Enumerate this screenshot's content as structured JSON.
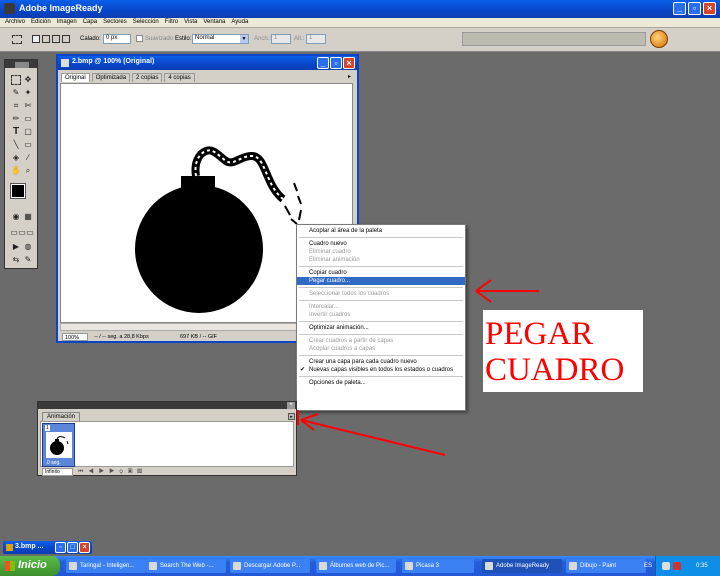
{
  "app": {
    "title": "Adobe ImageReady"
  },
  "menubar": [
    "Archivo",
    "Edición",
    "Imagen",
    "Capa",
    "Sectores",
    "Selección",
    "Filtro",
    "Vista",
    "Ventana",
    "Ayuda"
  ],
  "options_bar": {
    "calado_label": "Calado:",
    "calado_value": "0 px",
    "suavizado_label": "Suavizado",
    "estilo_label": "Estilo:",
    "estilo_value": "Normal",
    "ancho_label": "Anch.:",
    "ancho_value": "1",
    "alt_label": "Alt.:",
    "alt_value": "1"
  },
  "document": {
    "title": "2.bmp @ 100% (Original)",
    "tabs": [
      "Original",
      "Optimizada",
      "2 copias",
      "4 copias"
    ],
    "zoom": "100%",
    "status_speed": "-- / -- seg. a 28,8 Kbps",
    "status_size": "697 KB / -- GIF"
  },
  "context_menu": {
    "items": [
      {
        "label": "Acoplar al área de la paleta",
        "state": "normal"
      },
      {
        "sep": true
      },
      {
        "label": "Cuadro nuevo",
        "state": "normal"
      },
      {
        "label": "Eliminar cuadro",
        "state": "disabled"
      },
      {
        "label": "Eliminar animación",
        "state": "disabled"
      },
      {
        "sep": true
      },
      {
        "label": "Copiar cuadro",
        "state": "normal"
      },
      {
        "label": "Pegar cuadro...",
        "state": "highlighted"
      },
      {
        "sep": true
      },
      {
        "label": "Seleccionar todos los cuadros",
        "state": "disabled"
      },
      {
        "sep": true
      },
      {
        "label": "Intercalar...",
        "state": "disabled"
      },
      {
        "label": "Invertir cuadros",
        "state": "disabled"
      },
      {
        "sep": true
      },
      {
        "label": "Optimizar animación...",
        "state": "normal"
      },
      {
        "sep": true
      },
      {
        "label": "Crear cuadros a partir de capas",
        "state": "disabled"
      },
      {
        "label": "Acoplar cuadros a capas",
        "state": "disabled"
      },
      {
        "sep": true
      },
      {
        "label": "Crear una capa para cada cuadro nuevo",
        "state": "normal"
      },
      {
        "label": "Nuevas capas visibles en todos los estados o cuadros",
        "state": "checked"
      },
      {
        "sep": true
      },
      {
        "label": "Opciones de paleta...",
        "state": "normal"
      }
    ]
  },
  "annotation": {
    "line1": "PEGAR",
    "line2": "CUADRO",
    "color": "#ff0000"
  },
  "animation_palette": {
    "tab": "Animación",
    "frame_number": "1",
    "frame_delay": "0 seg.",
    "loop": "Infinito"
  },
  "minimized_doc": {
    "title": "3.bmp ..."
  },
  "taskbar": {
    "start": "Inicio",
    "items": [
      "Taringa! - Inteligen...",
      "Search The Web -...",
      "Descargar Adobe P...",
      "Álbumes web de Pic...",
      "Picasa 3",
      "Adobe ImageReady",
      "Dibujo - Paint"
    ],
    "active": "Adobe ImageReady",
    "lang": "ES",
    "time": "0:35"
  }
}
